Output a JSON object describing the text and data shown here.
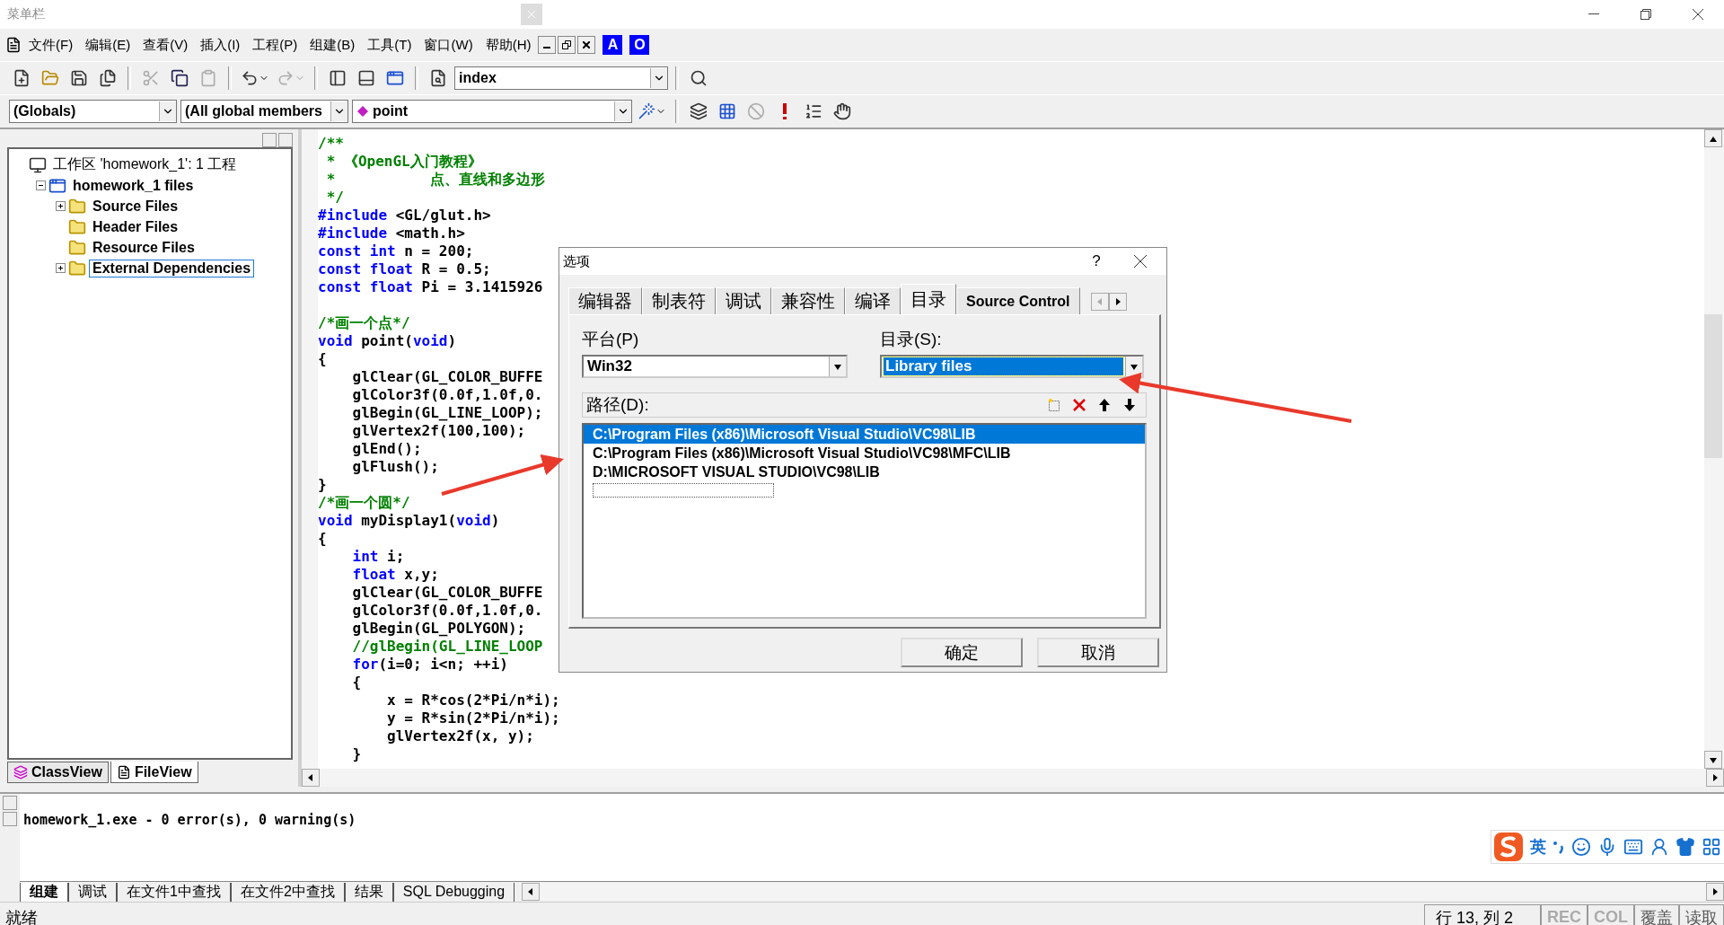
{
  "title_bar": {
    "title": "菜单栏"
  },
  "menu_bar": {
    "items": [
      "文件(F)",
      "编辑(E)",
      "查看(V)",
      "插入(I)",
      "工程(P)",
      "组建(B)",
      "工具(T)",
      "窗口(W)",
      "帮助(H)"
    ],
    "badges": [
      "A",
      "O"
    ]
  },
  "toolbar": {
    "items": [
      {
        "kind": "new",
        "disabled": false
      },
      {
        "kind": "open",
        "disabled": false
      },
      {
        "kind": "save",
        "disabled": false
      },
      {
        "kind": "save_all",
        "disabled": false
      },
      {
        "kind": "separator"
      },
      {
        "kind": "cut",
        "disabled": true
      },
      {
        "kind": "copy",
        "disabled": false
      },
      {
        "kind": "paste",
        "disabled": true
      },
      {
        "kind": "separator"
      },
      {
        "kind": "undo",
        "disabled": false
      },
      {
        "kind": "redo",
        "disabled": true
      },
      {
        "kind": "separator"
      },
      {
        "kind": "workspace",
        "disabled": false
      },
      {
        "kind": "output",
        "disabled": false
      },
      {
        "kind": "windows",
        "disabled": false
      },
      {
        "kind": "separator"
      },
      {
        "kind": "find_in_files",
        "disabled": false
      },
      {
        "kind": "combo",
        "value": "index"
      },
      {
        "kind": "separator"
      },
      {
        "kind": "find",
        "disabled": false
      }
    ]
  },
  "wizard_bar": {
    "combos": [
      {
        "kind": "plain",
        "value": "(Globals)"
      },
      {
        "kind": "plain",
        "value": "(All global members"
      },
      {
        "kind": "member",
        "value": "point"
      }
    ],
    "items": [
      {
        "kind": "wizard",
        "disabled": false
      },
      {
        "kind": "separator"
      },
      {
        "kind": "compile",
        "disabled": false
      },
      {
        "kind": "build",
        "disabled": false
      },
      {
        "kind": "stop",
        "disabled": true
      },
      {
        "kind": "execute",
        "disabled": false
      },
      {
        "kind": "step",
        "disabled": false
      },
      {
        "kind": "hand",
        "disabled": false
      }
    ]
  },
  "workspace": {
    "tree": [
      {
        "kind": "workspace",
        "label": "工作区 'homework_1': 1 工程",
        "selected": false,
        "expandable": false,
        "children": [
          {
            "kind": "project",
            "label": "homework_1 files",
            "selected": false,
            "expandable": true,
            "expanded": true,
            "children": [
              {
                "kind": "folder",
                "label": "Source Files",
                "selected": false,
                "expandable": true,
                "expanded": false
              },
              {
                "kind": "folder",
                "label": "Header Files",
                "selected": false,
                "expandable": false
              },
              {
                "kind": "folder",
                "label": "Resource Files",
                "selected": false,
                "expandable": false
              },
              {
                "kind": "folder",
                "label": "External Dependencies",
                "selected": true,
                "expandable": true,
                "expanded": false
              }
            ]
          }
        ]
      }
    ],
    "tabs": [
      {
        "label": "ClassView",
        "selected": false
      },
      {
        "label": "FileView",
        "selected": true
      }
    ]
  },
  "editor": {
    "lines": [
      {
        "kind": "code",
        "segments": [
          {
            "kind": "comment",
            "text": "/**"
          }
        ]
      },
      {
        "kind": "code",
        "segments": [
          {
            "kind": "comment",
            "text": " * 《OpenGL入门教程》"
          }
        ]
      },
      {
        "kind": "code",
        "segments": [
          {
            "kind": "comment",
            "text": " *           点、直线和多边形"
          }
        ]
      },
      {
        "kind": "code",
        "segments": [
          {
            "kind": "comment",
            "text": " */"
          }
        ]
      },
      {
        "kind": "code",
        "segments": [
          {
            "kind": "keyword",
            "text": "#include"
          },
          {
            "kind": "text",
            "text": " <GL/glut.h>"
          }
        ]
      },
      {
        "kind": "code",
        "segments": [
          {
            "kind": "keyword",
            "text": "#include"
          },
          {
            "kind": "text",
            "text": " <math.h>"
          }
        ]
      },
      {
        "kind": "code",
        "segments": [
          {
            "kind": "keyword",
            "text": "const int"
          },
          {
            "kind": "text",
            "text": " n = 200;"
          }
        ]
      },
      {
        "kind": "code",
        "segments": [
          {
            "kind": "keyword",
            "text": "const float"
          },
          {
            "kind": "text",
            "text": " R = 0.5;"
          }
        ]
      },
      {
        "kind": "code",
        "segments": [
          {
            "kind": "keyword",
            "text": "const float"
          },
          {
            "kind": "text",
            "text": " Pi = 3.1415926"
          }
        ]
      },
      {
        "kind": "blank"
      },
      {
        "kind": "code",
        "segments": [
          {
            "kind": "comment",
            "text": "/*画一个点*/"
          }
        ]
      },
      {
        "kind": "code",
        "segments": [
          {
            "kind": "keyword",
            "text": "void"
          },
          {
            "kind": "text",
            "text": " point("
          },
          {
            "kind": "keyword",
            "text": "void"
          },
          {
            "kind": "text",
            "text": ")"
          }
        ]
      },
      {
        "kind": "code",
        "segments": [
          {
            "kind": "text",
            "text": "{"
          }
        ]
      },
      {
        "kind": "code",
        "segments": [
          {
            "kind": "text",
            "text": "    glClear(GL_COLOR_BUFFE"
          }
        ]
      },
      {
        "kind": "code",
        "segments": [
          {
            "kind": "text",
            "text": "    glColor3f(0.0f,1.0f,0."
          }
        ]
      },
      {
        "kind": "code",
        "segments": [
          {
            "kind": "text",
            "text": "    glBegin(GL_LINE_LOOP);"
          }
        ]
      },
      {
        "kind": "code",
        "segments": [
          {
            "kind": "text",
            "text": "    glVertex2f(100,100);"
          }
        ]
      },
      {
        "kind": "code",
        "segments": [
          {
            "kind": "text",
            "text": "    glEnd();"
          }
        ]
      },
      {
        "kind": "code",
        "segments": [
          {
            "kind": "text",
            "text": "    glFlush();"
          }
        ]
      },
      {
        "kind": "code",
        "segments": [
          {
            "kind": "text",
            "text": "}"
          }
        ]
      },
      {
        "kind": "code",
        "segments": [
          {
            "kind": "comment",
            "text": "/*画一个圆*/"
          }
        ]
      },
      {
        "kind": "code",
        "segments": [
          {
            "kind": "keyword",
            "text": "void"
          },
          {
            "kind": "text",
            "text": " myDisplay1("
          },
          {
            "kind": "keyword",
            "text": "void"
          },
          {
            "kind": "text",
            "text": ")"
          }
        ]
      },
      {
        "kind": "code",
        "segments": [
          {
            "kind": "text",
            "text": "{"
          }
        ]
      },
      {
        "kind": "code",
        "segments": [
          {
            "kind": "keyword",
            "text": "    int"
          },
          {
            "kind": "text",
            "text": " i;"
          }
        ]
      },
      {
        "kind": "code",
        "segments": [
          {
            "kind": "keyword",
            "text": "    float"
          },
          {
            "kind": "text",
            "text": " x,y;"
          }
        ]
      },
      {
        "kind": "code",
        "segments": [
          {
            "kind": "text",
            "text": "    glClear(GL_COLOR_BUFFE"
          }
        ]
      },
      {
        "kind": "code",
        "segments": [
          {
            "kind": "text",
            "text": "    glColor3f(0.0f,1.0f,0."
          }
        ]
      },
      {
        "kind": "code",
        "segments": [
          {
            "kind": "text",
            "text": "    glBegin(GL_POLYGON);"
          }
        ]
      },
      {
        "kind": "code",
        "segments": [
          {
            "kind": "comment",
            "text": "    //glBegin(GL_LINE_LOOP"
          }
        ]
      },
      {
        "kind": "code",
        "segments": [
          {
            "kind": "keyword",
            "text": "    for"
          },
          {
            "kind": "text",
            "text": "(i=0; i<n; ++i)"
          }
        ]
      },
      {
        "kind": "code",
        "segments": [
          {
            "kind": "text",
            "text": "    {"
          }
        ]
      },
      {
        "kind": "code",
        "segments": [
          {
            "kind": "text",
            "text": "        x = R*cos(2*Pi/n*i);"
          }
        ]
      },
      {
        "kind": "code",
        "segments": [
          {
            "kind": "text",
            "text": "        y = R*sin(2*Pi/n*i);"
          }
        ]
      },
      {
        "kind": "code",
        "segments": [
          {
            "kind": "text",
            "text": "        glVertex2f(x, y);"
          }
        ]
      },
      {
        "kind": "code",
        "segments": [
          {
            "kind": "text",
            "text": "    }"
          }
        ]
      }
    ]
  },
  "dialog": {
    "title": "选项",
    "help": "?",
    "tabs": [
      {
        "label": "编辑器",
        "selected": false
      },
      {
        "label": "制表符",
        "selected": false
      },
      {
        "label": "调试",
        "selected": false
      },
      {
        "label": "兼容性",
        "selected": false
      },
      {
        "label": "编译",
        "selected": false
      },
      {
        "label": "目录",
        "selected": true
      },
      {
        "label": "Source Control",
        "selected": false
      }
    ],
    "platform": {
      "label": "平台(P)",
      "value": "Win32",
      "focused": false
    },
    "directory": {
      "label": "目录(S):",
      "value": "Library files",
      "focused": true
    },
    "paths": {
      "label": "路径(D):",
      "items": [
        {
          "text": "C:\\Program Files (x86)\\Microsoft Visual Studio\\VC98\\LIB",
          "selected": true
        },
        {
          "text": "C:\\Program Files (x86)\\Microsoft Visual Studio\\VC98\\MFC\\LIB",
          "selected": false
        },
        {
          "text": "D:\\MICROSOFT VISUAL STUDIO\\VC98\\LIB",
          "selected": false
        }
      ]
    },
    "buttons": [
      "确定",
      "取消"
    ]
  },
  "output": {
    "text": "homework_1.exe - 0 error(s), 0 warning(s)",
    "tabs": [
      {
        "label": "组建",
        "selected": true
      },
      {
        "label": "调试",
        "selected": false
      },
      {
        "label": "在文件1中查找",
        "selected": false
      },
      {
        "label": "在文件2中查找",
        "selected": false
      },
      {
        "label": "结果",
        "selected": false
      },
      {
        "label": "SQL Debugging",
        "selected": false
      }
    ]
  },
  "ime_bar": {
    "mode": "英"
  },
  "status_bar": {
    "message": "就绪",
    "position": "行 13, 列 2",
    "indicators": [
      {
        "label": "REC",
        "disabled": true
      },
      {
        "label": "COL",
        "disabled": true
      },
      {
        "label": "覆盖",
        "disabled": false
      },
      {
        "label": "读取",
        "disabled": false
      }
    ]
  }
}
